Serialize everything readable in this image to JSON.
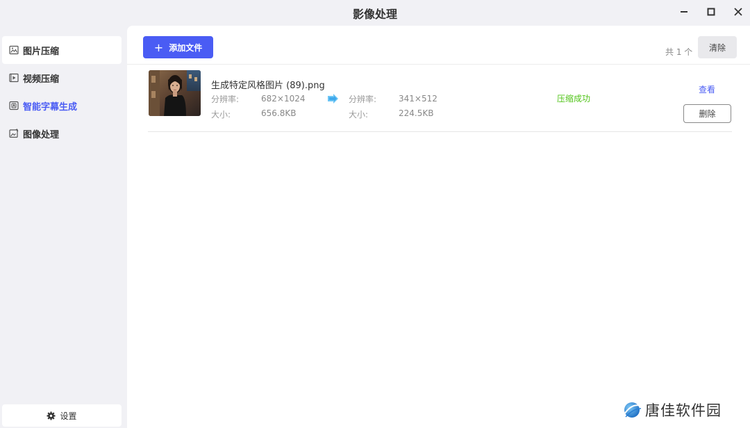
{
  "window": {
    "title": "影像处理"
  },
  "sidebar": {
    "items": [
      {
        "label": "图片压缩",
        "icon": "image-icon"
      },
      {
        "label": "视频压缩",
        "icon": "video-icon"
      },
      {
        "label": "智能字幕生成",
        "icon": "subtitle-icon"
      },
      {
        "label": "图像处理",
        "icon": "image-edit-icon"
      }
    ],
    "settings_label": "设置"
  },
  "toolbar": {
    "add_label": "添加文件",
    "count_text": "共 1 个",
    "clear_label": "清除"
  },
  "files": [
    {
      "name": "生成特定风格图片 (89).png",
      "resolution_label": "分辨率:",
      "size_label": "大小:",
      "original_resolution": "682×1024",
      "original_size": "656.8KB",
      "compressed_resolution": "341×512",
      "compressed_size": "224.5KB",
      "status": "压缩成功",
      "view_label": "查看",
      "delete_label": "删除"
    }
  ],
  "watermark": {
    "text": "唐佳软件园"
  },
  "colors": {
    "accent": "#4a5cf4",
    "success": "#52c41a",
    "background": "#f1f1f5"
  }
}
